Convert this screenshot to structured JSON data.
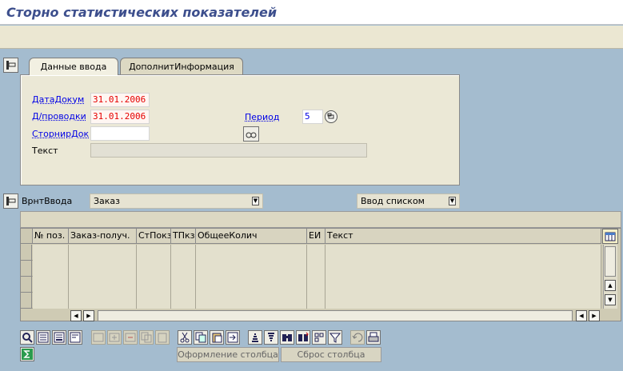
{
  "window": {
    "title": "Сторно статистических показателей"
  },
  "tabs": [
    {
      "label": "Данные ввода",
      "active": true
    },
    {
      "label": "ДополнитИнформация",
      "active": false
    }
  ],
  "form": {
    "date_doc": {
      "label": "ДатаДокум",
      "value": "31.01.2006"
    },
    "date_post": {
      "label": "Д/проводки",
      "value": "31.01.2006"
    },
    "reversal_doc": {
      "label": "СторнирДок",
      "value": ""
    },
    "text": {
      "label": "Текст",
      "value": ""
    },
    "period": {
      "label": "Период",
      "value": "5"
    }
  },
  "entry_variant": {
    "label": "ВрнтВвода",
    "selected": "Заказ",
    "mode_selected": "Ввод списком"
  },
  "table": {
    "columns": [
      "№ поз.",
      "Заказ-получ.",
      "СтПокз",
      "ТПкз",
      "ОбщееКолич",
      "ЕИ",
      "Текст"
    ],
    "rows": [
      [
        "",
        "",
        "",
        "",
        "",
        "",
        ""
      ],
      [
        "",
        "",
        "",
        "",
        "",
        "",
        ""
      ],
      [
        "",
        "",
        "",
        "",
        "",
        "",
        ""
      ],
      [
        "",
        "",
        "",
        "",
        "",
        "",
        ""
      ]
    ]
  },
  "toolbar": {
    "column_format_label": "Оформление столбца",
    "column_reset_label": "Сброс столбца"
  },
  "colors": {
    "background": "#a4bccf",
    "title": "#3d4f8d",
    "field_label_link": "#0000e6",
    "date_value": "#e60000",
    "panel": "#ebe8d6"
  }
}
